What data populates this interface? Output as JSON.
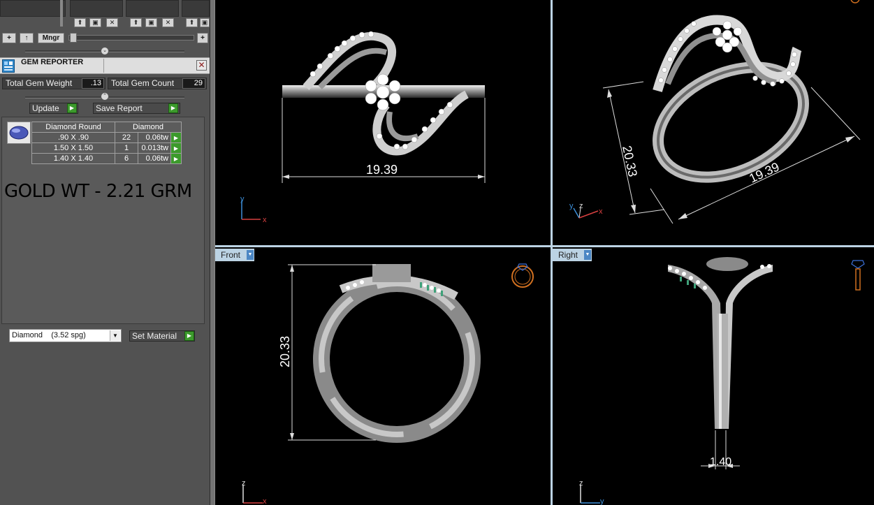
{
  "toolbar": {
    "add_label": "+",
    "up_label": "↑",
    "mngr_label": "Mngr",
    "plus_right_label": "+"
  },
  "gem_reporter": {
    "title": "GEM REPORTER",
    "total_gem_weight_label": "Total Gem Weight",
    "total_gem_weight_value": ".13",
    "total_gem_count_label": "Total Gem Count",
    "total_gem_count_value": "29",
    "update_label": "Update",
    "save_report_label": "Save Report",
    "table": {
      "headers": [
        "Diamond Round",
        "Diamond"
      ],
      "rows": [
        {
          "size": ".90 X .90",
          "count": "22",
          "weight": "0.06tw"
        },
        {
          "size": "1.50 X 1.50",
          "count": "1",
          "weight": "0.013tw"
        },
        {
          "size": "1.40 X 1.40",
          "count": "6",
          "weight": "0.06tw"
        }
      ]
    },
    "gold_weight_text": "GOLD WT - 2.21 GRM",
    "material_value": "Diamond    (3.52 spg)",
    "set_material_label": "Set Material"
  },
  "viewports": {
    "top_left": {
      "dimension": "19.39",
      "axis_y": "y",
      "axis_x": "x"
    },
    "top_right": {
      "dimension_a": "20.33",
      "dimension_b": "19.39",
      "axis_y": "y",
      "axis_z": "z",
      "axis_x": "x"
    },
    "front": {
      "tab_label": "Front",
      "dimension": "20.33",
      "axis_z": "z",
      "axis_x": "x"
    },
    "right": {
      "tab_label": "Right",
      "dimension": "1.40",
      "axis_z": "z",
      "axis_y": "y"
    }
  },
  "colors": {
    "panel_bg": "#525252",
    "viewport_bg": "#000000",
    "separator": "#bcd3e4",
    "accent_green": "#3c9a2c",
    "tab_arrow_blue": "#4c87c4"
  },
  "icons": [
    "gem-reporter-icon",
    "close-icon",
    "play-icon",
    "gem-thumbnail-icon",
    "ring-icon",
    "chevron-down-icon",
    "axis-icon"
  ]
}
